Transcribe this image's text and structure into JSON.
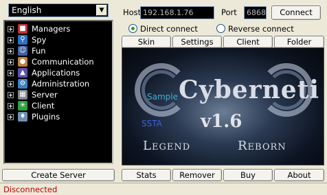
{
  "language": {
    "selected": "English"
  },
  "tree": [
    {
      "label": "Managers",
      "icon": "managers-icon",
      "color": "#c03030"
    },
    {
      "label": "Spy",
      "icon": "spy-icon",
      "color": "#3070c0"
    },
    {
      "label": "Fun",
      "icon": "fun-icon",
      "color": "#4060a0"
    },
    {
      "label": "Communication",
      "icon": "communication-icon",
      "color": "#c08040"
    },
    {
      "label": "Applications",
      "icon": "applications-icon",
      "color": "#6050b0"
    },
    {
      "label": "Administration",
      "icon": "administration-icon",
      "color": "#4080c0"
    },
    {
      "label": "Server",
      "icon": "server-icon",
      "color": "#808890"
    },
    {
      "label": "Client",
      "icon": "client-icon",
      "color": "#30a040"
    },
    {
      "label": "Plugins",
      "icon": "plugins-icon",
      "color": "#7090b0"
    }
  ],
  "connection": {
    "host_label": "Host",
    "host_value": "192.168.1.76",
    "port_label": "Port",
    "port_value": "6868",
    "connect_label": "Connect",
    "direct_label": "Direct connect",
    "reverse_label": "Reverse connect",
    "mode": "direct"
  },
  "top_buttons": {
    "skin": "Skin",
    "settings": "Settings",
    "client": "Client",
    "folder": "Folder"
  },
  "banner": {
    "title": "Cyberneti",
    "sample": "Sample",
    "ssta": "SSTA",
    "version": "v1.6",
    "legend": "Legend",
    "reborn": "Reborn"
  },
  "bottom_buttons": {
    "create_server": "Create Server",
    "stats": "Stats",
    "remover": "Remover",
    "buy": "Buy",
    "about": "About"
  },
  "status": {
    "text": "Disconnected",
    "color": "#c00000"
  }
}
